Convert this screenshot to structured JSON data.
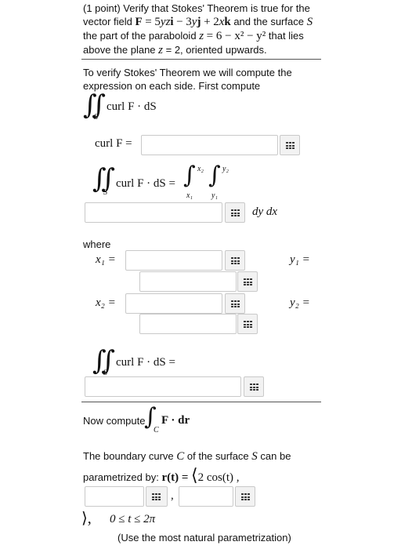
{
  "problem": {
    "points": "(1 point) Verify that Stokes' Theorem is true for the",
    "line2_pre": "vector field",
    "field_F": "F",
    "eq": "=",
    "field_expr_1": "5",
    "field_var_y": "y",
    "field_var_z": "z",
    "vec_i": "i",
    "field_expr_2": "−",
    "coef_3": "3",
    "vec_j": "j",
    "plus": "+",
    "coef_2": "2",
    "var_x": "x",
    "vec_k": "k",
    "line2_post": "and the surface",
    "surface_S": "S",
    "line3_pre": "the part of the paraboloid",
    "parab_z": "z",
    "parab_expr": "= 6 − x² − y²",
    "line3_post": "that lies",
    "line4_pre": "above the plane",
    "plane_z": "z",
    "plane_expr": "= 2, oriented upwards."
  },
  "section1": {
    "intro1": "To verify Stokes' Theorem we will compute the",
    "intro2": "expression on each side. First compute",
    "curlF_dS": "curl F · dS",
    "curlF_label": "curl F =",
    "integral_label": "curl F · dS =",
    "x1": "x₁",
    "x2": "x₂",
    "y1": "y₁",
    "y2": "y₂",
    "dydx": "dy dx",
    "where": "where",
    "x1_eq": "x₁  =",
    "x2_eq": "x₂  =",
    "y1_eq": "y₁  =",
    "y2_eq": "y₂  =",
    "final_label": "curl F · dS ="
  },
  "section2": {
    "now_compute": "Now compute",
    "F_dr": "F · dr",
    "C": "C",
    "boundary1_pre": "The boundary curve",
    "boundary1_C": "C",
    "boundary1_mid": "of the surface",
    "boundary1_S": "S",
    "boundary1_post": "can be",
    "param_pre": "parametrized by:",
    "r_t": "r(t) =",
    "first_comp": "2 cos(t) ,",
    "comma": ",",
    "close": "⟩,",
    "t_range": "0 ≤ t ≤ 2π",
    "note": "(Use the most natural parametrization)"
  },
  "inputs": {
    "curlF": "",
    "double_integral": "",
    "x1": "",
    "y1": "",
    "x2": "",
    "y2": "",
    "final": "",
    "r_y": "",
    "r_z": ""
  }
}
